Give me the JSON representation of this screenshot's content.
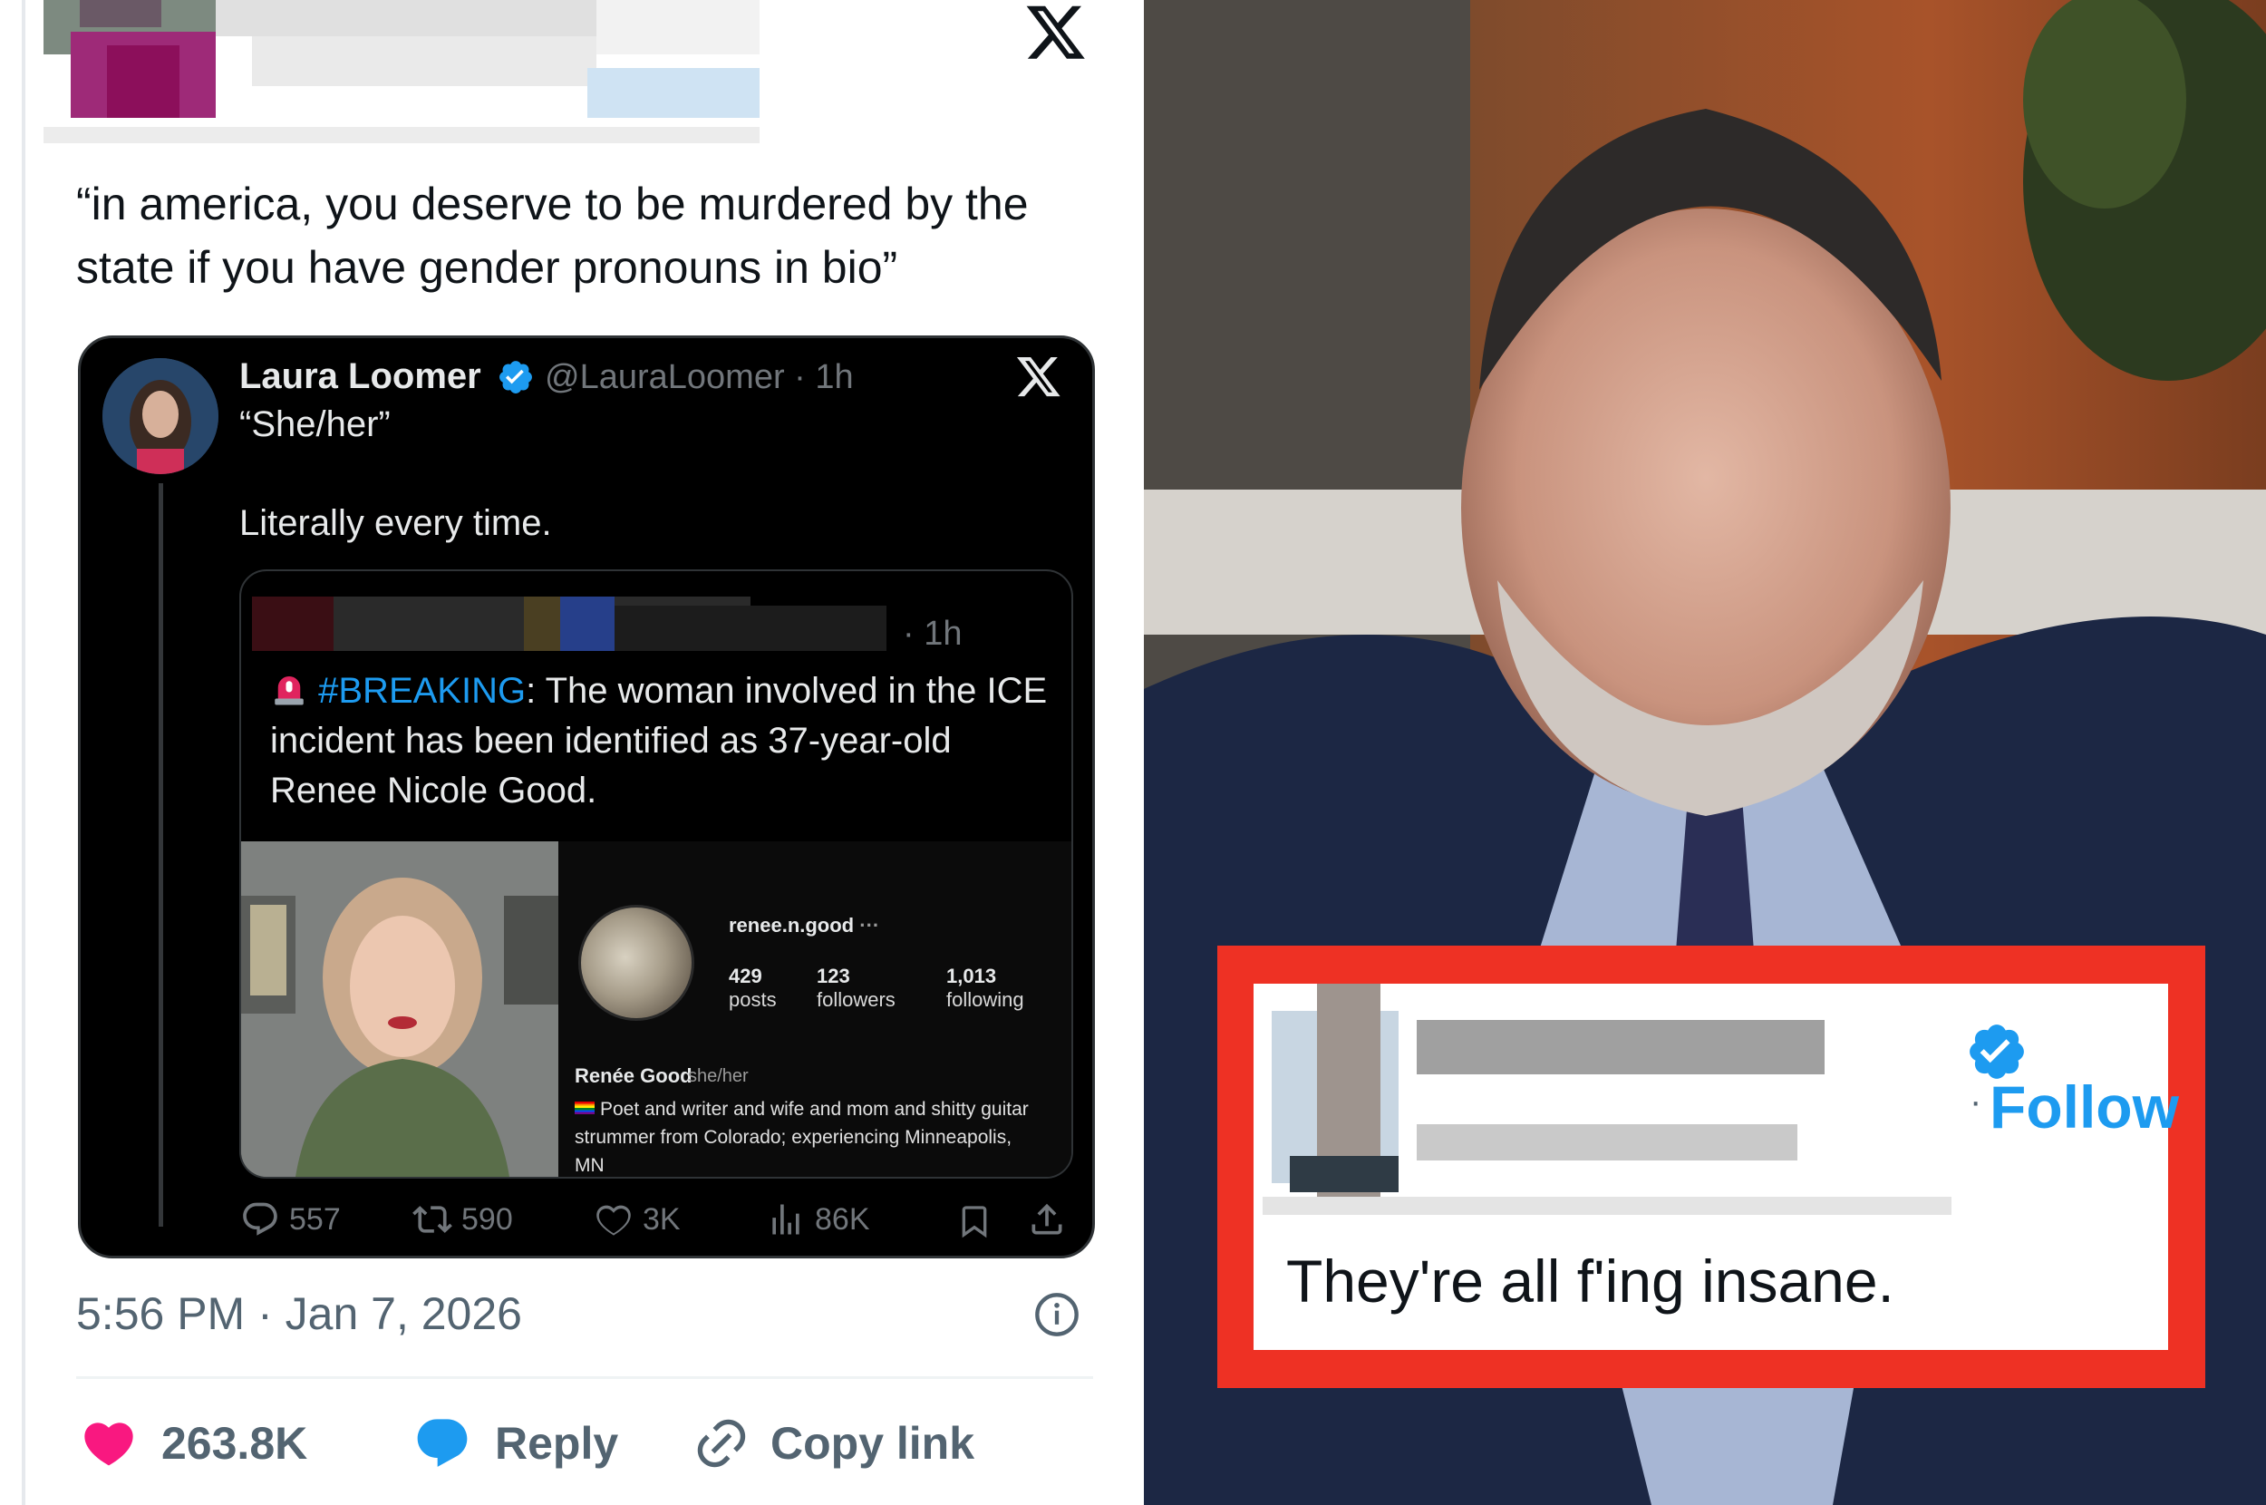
{
  "left_tweet": {
    "text": "“in america, you deserve to be murdered by the state if you have gender pronouns in bio”",
    "embedded": {
      "author_name": "Laura Loomer",
      "author_handle_time": "@LauraLoomer · 1h",
      "line1": "“She/her”",
      "line2": "Literally every time.",
      "quoted": {
        "time": "· 1h",
        "hashtag": "#BREAKING",
        "text_rest": ": The woman involved in the ICE incident has been identified as 37-year-old Renee Nicole Good.",
        "profile": {
          "username": "renee.n.good",
          "posts_count": "429",
          "posts_label": "posts",
          "followers_count": "123",
          "followers_label": "followers",
          "following_count": "1,013",
          "following_label": "following",
          "name": "Renée Good",
          "pronouns": "she/her",
          "bio": "Poet and writer and wife and mom and shitty guitar strummer from Colorado; experiencing Minneapolis, MN"
        }
      },
      "actions": {
        "replies": "557",
        "reposts": "590",
        "likes": "3K",
        "views": "86K"
      }
    },
    "timestamp": "5:56 PM · Jan 7, 2026",
    "bottom_actions": {
      "likes": "263.8K",
      "reply_label": "Reply",
      "copy_link_label": "Copy link"
    }
  },
  "right_overlay": {
    "follow_label": "Follow",
    "dot": "·",
    "text": "They're all f'ing insane."
  },
  "colors": {
    "x_blue": "#1d9bf0",
    "heart_pink": "#f91880",
    "overlay_red": "#ee3124"
  }
}
